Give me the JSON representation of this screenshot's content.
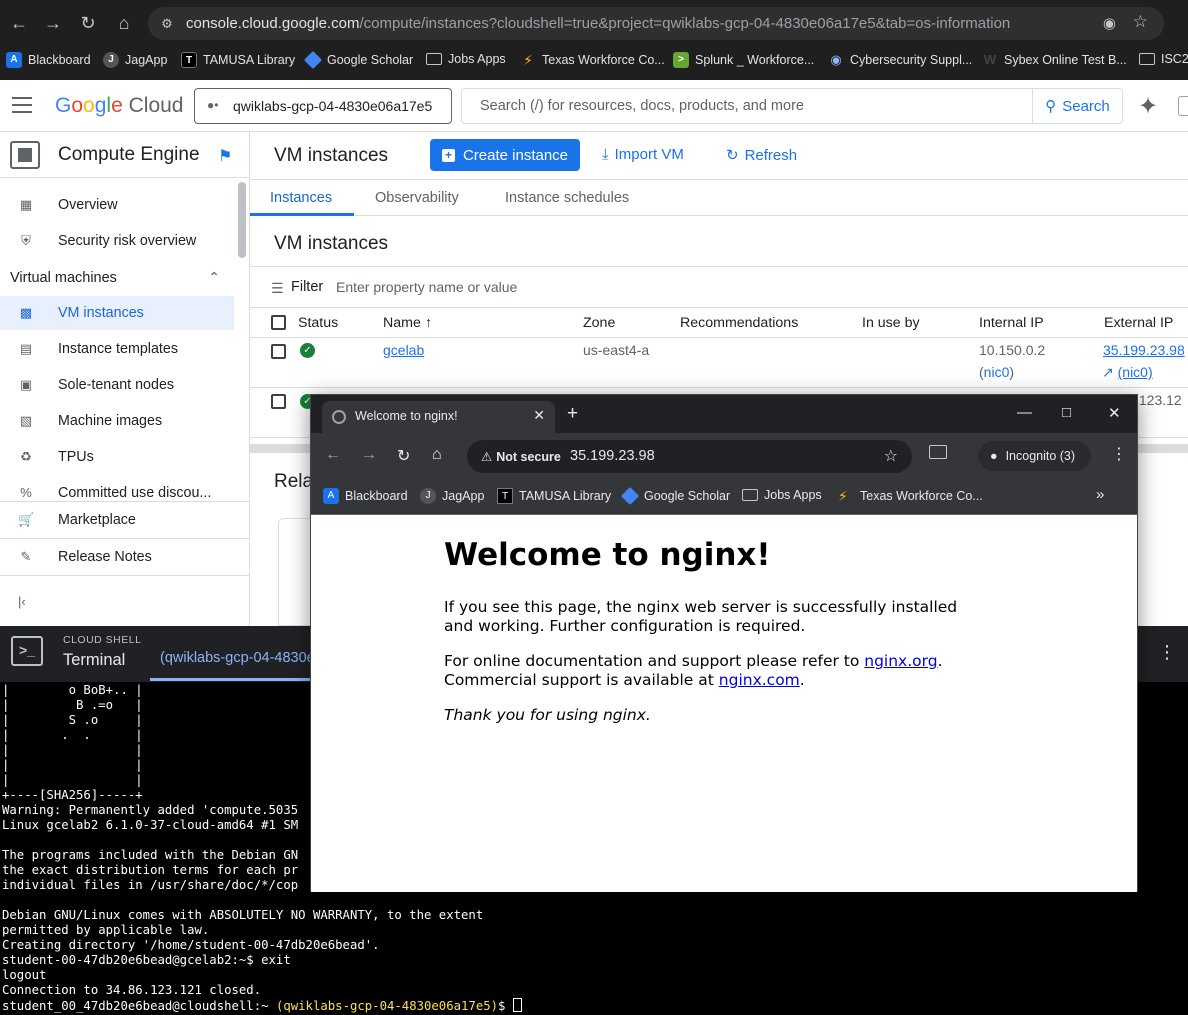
{
  "browser": {
    "url_host": "console.cloud.google.com",
    "url_rest": "/compute/instances?cloudshell=true&project=qwiklabs-gcp-04-4830e06a17e5&tab=os-information",
    "bookmarks": [
      "Blackboard",
      "JagApp",
      "TAMUSA Library",
      "Google Scholar",
      "Jobs Apps",
      "Texas Workforce Co...",
      "Splunk _ Workforce...",
      "Cybersecurity Suppl...",
      "Sybex Online Test B...",
      "ISC2"
    ]
  },
  "gcp": {
    "logo_google": "Google",
    "logo_cloud": "Cloud",
    "project": "qwiklabs-gcp-04-4830e06a17e5",
    "search_placeholder": "Search (/) for resources, docs, products, and more",
    "search_button": "Search"
  },
  "sidenav": {
    "product": "Compute Engine",
    "items_top": [
      "Overview",
      "Security risk overview"
    ],
    "section": "Virtual machines",
    "items_vm": [
      "VM instances",
      "Instance templates",
      "Sole-tenant nodes",
      "Machine images",
      "TPUs",
      "Committed use discou..."
    ],
    "items_bottom": [
      "Marketplace",
      "Release Notes"
    ]
  },
  "main": {
    "title": "VM instances",
    "create_button": "Create instance",
    "import_button": "Import VM",
    "refresh_button": "Refresh",
    "tabs": [
      "Instances",
      "Observability",
      "Instance schedules"
    ],
    "section_title": "VM instances",
    "filter_label": "Filter",
    "filter_placeholder": "Enter property name or value",
    "columns": [
      "Status",
      "Name",
      "Zone",
      "Recommendations",
      "In use by",
      "Internal IP",
      "External IP"
    ],
    "rows": [
      {
        "name": "gcelab",
        "zone": "us-east4-a",
        "internal_ip": "10.150.0.2",
        "nic": "(nic0)",
        "external_ip": "35.199.23.98",
        "external_nic": "(nic0)"
      },
      {
        "external_ip_partial": ".123.12"
      }
    ],
    "related_title": "Rela"
  },
  "cloudshell": {
    "label": "CLOUD SHELL",
    "terminal_label": "Terminal",
    "tab": "(qwiklabs-gcp-04-4830e",
    "lines": [
      "|        o BoB+.. |",
      "|         B .=o   |",
      "|        S .o     |",
      "|       .  .      |",
      "|                 |",
      "|                 |",
      "|                 |",
      "+----[SHA256]-----+",
      "Warning: Permanently added 'compute.5035",
      "Linux gcelab2 6.1.0-37-cloud-amd64 #1 SM",
      "",
      "The programs included with the Debian GN",
      "the exact distribution terms for each pr",
      "individual files in /usr/share/doc/*/cop",
      "",
      "Debian GNU/Linux comes with ABSOLUTELY NO WARRANTY, to the extent",
      "permitted by applicable law.",
      "Creating directory '/home/student-00-47db20e6bead'.",
      "student-00-47db20e6bead@gcelab2:~$ exit",
      "logout",
      "Connection to 34.86.123.121 closed."
    ],
    "prompt_user": "student_00_47db20e6bead@cloudshell:~",
    "prompt_project": "(qwiklabs-gcp-04-4830e06a17e5)",
    "prompt_symbol": "$"
  },
  "popup": {
    "tab_title": "Welcome to nginx!",
    "not_secure": "Not secure",
    "url": "35.199.23.98",
    "incognito": "Incognito (3)",
    "bookmarks": [
      "Blackboard",
      "JagApp",
      "TAMUSA Library",
      "Google Scholar",
      "Jobs Apps",
      "Texas Workforce Co..."
    ],
    "heading": "Welcome to nginx!",
    "para1": "If you see this page, the nginx web server is successfully installed and working. Further configuration is required.",
    "para2_a": "For online documentation and support please refer to ",
    "para2_link1": "nginx.org",
    "para2_b": ".",
    "para2_c": "Commercial support is available at ",
    "para2_link2": "nginx.com",
    "para2_d": ".",
    "para3": "Thank you for using nginx."
  }
}
